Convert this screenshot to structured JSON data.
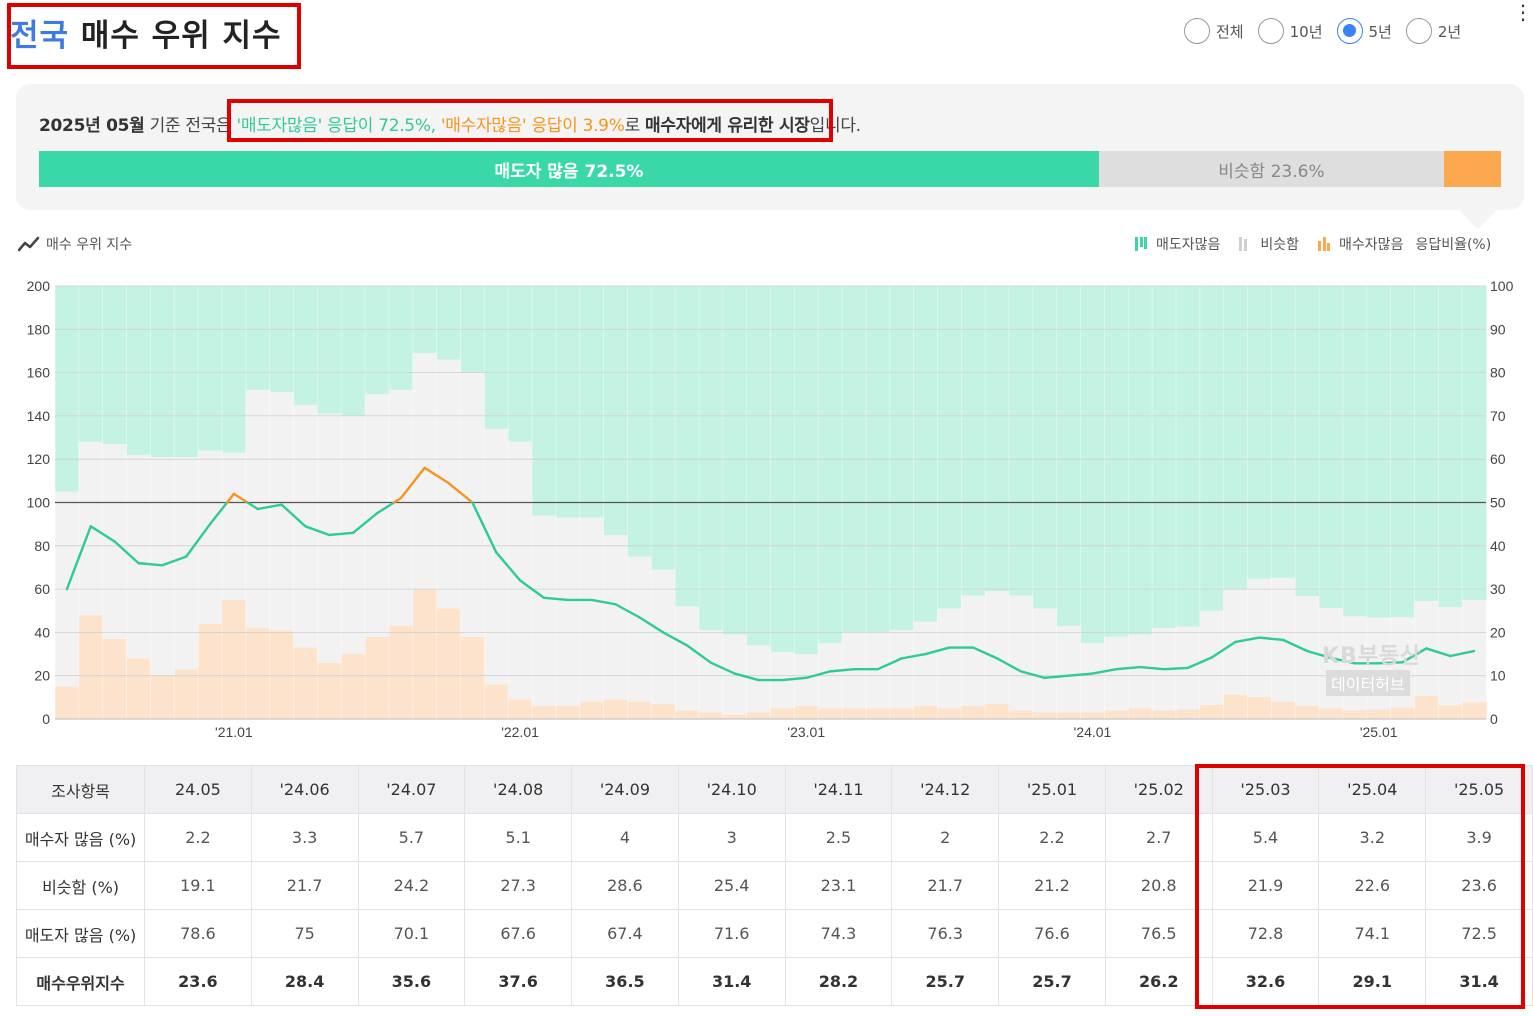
{
  "header": {
    "title_accent": "전국",
    "title_rest": " 매수 우위 지수",
    "period_options": [
      "전체",
      "10년",
      "5년",
      "2년"
    ],
    "selected_period": "5년"
  },
  "summary": {
    "date": "2025년 05월",
    "prefix": " 기준 전국은 ",
    "seller_phrase": "'매도자많음' 응답이 72.5%, ",
    "buyer_phrase": "'매수자많음' 응답이 3.9%",
    "connector": "로 ",
    "market": "매수자에게 유리한 시장",
    "suffix": "입니다.",
    "bar": {
      "seller_label": "매도자 많음 72.5%",
      "similar_label": "비슷함 23.6%",
      "seller_pct": 72.5,
      "similar_pct": 23.6,
      "buyer_pct": 3.9
    }
  },
  "chart_section": {
    "title": "매수 우위 지수",
    "legend": [
      "매도자많음",
      "비슷함",
      "매수자많음"
    ],
    "right_axis_unit": "응답비율(%)",
    "watermark_line1": "KB부동산",
    "watermark_line2": "데이터허브"
  },
  "colors": {
    "seller": "#3ad8a8",
    "seller_area": "#c4f2e3",
    "similar_area": "#f2f2f2",
    "buyer": "#fca84e",
    "buyer_area": "#fde3cb",
    "line_green": "#2ecb92",
    "line_orange": "#f7941d",
    "highlight": "#e00000",
    "accent_blue": "#3c7be0"
  },
  "chart_data": {
    "type": "area",
    "x_tick_labels": [
      "'21.01",
      "'22.01",
      "'23.01",
      "'24.01",
      "'25.01"
    ],
    "left_axis": {
      "range": [
        0,
        200
      ],
      "ticks": [
        0,
        20,
        40,
        60,
        80,
        100,
        120,
        140,
        160,
        180,
        200
      ]
    },
    "right_axis": {
      "range": [
        0,
        100
      ],
      "ticks": [
        0,
        10,
        20,
        30,
        40,
        50,
        60,
        70,
        80,
        90,
        100
      ],
      "label": "응답비율(%)"
    },
    "reference_line": 100,
    "x": [
      "20.06",
      "20.07",
      "20.08",
      "20.09",
      "20.10",
      "20.11",
      "20.12",
      "21.01",
      "21.02",
      "21.03",
      "21.04",
      "21.05",
      "21.06",
      "21.07",
      "21.08",
      "21.09",
      "21.10",
      "21.11",
      "21.12",
      "22.01",
      "22.02",
      "22.03",
      "22.04",
      "22.05",
      "22.06",
      "22.07",
      "22.08",
      "22.09",
      "22.10",
      "22.11",
      "22.12",
      "23.01",
      "23.02",
      "23.03",
      "23.04",
      "23.05",
      "23.06",
      "23.07",
      "23.08",
      "23.09",
      "23.10",
      "23.11",
      "23.12",
      "24.01",
      "24.02",
      "24.03",
      "24.04",
      "24.05",
      "24.06",
      "24.07",
      "24.08",
      "24.09",
      "24.10",
      "24.11",
      "24.12",
      "25.01",
      "25.02",
      "25.03",
      "25.04",
      "25.05"
    ],
    "series": [
      {
        "name": "매수자많음",
        "axis": "right",
        "values": [
          7.5,
          24,
          18.5,
          14,
          10,
          11.5,
          22,
          27.5,
          21,
          20.5,
          16.5,
          13,
          15,
          19,
          21.5,
          30,
          25.5,
          19,
          8,
          4.5,
          3,
          3,
          4,
          4.5,
          4,
          3.5,
          2,
          1.5,
          1,
          1.5,
          2.5,
          3,
          2.5,
          2.5,
          2.5,
          2.5,
          3,
          2.5,
          3,
          3.5,
          2,
          1.5,
          1.5,
          1.5,
          2,
          2.5,
          2,
          2.2,
          3.3,
          5.7,
          5.1,
          4,
          3,
          2.5,
          2,
          2.2,
          2.7,
          5.4,
          3.2,
          3.9
        ]
      },
      {
        "name": "비슷함",
        "axis": "right",
        "values": [
          45,
          40,
          45,
          47,
          50.5,
          49,
          40,
          34,
          55,
          55,
          56,
          57.5,
          55,
          56,
          54.5,
          54.5,
          57.5,
          61,
          59,
          59.5,
          44,
          43.5,
          42.5,
          38,
          33.5,
          31,
          24,
          19,
          18.5,
          15.5,
          13,
          12,
          15,
          17.5,
          17.5,
          18,
          19.5,
          23,
          25.5,
          26,
          26.5,
          24,
          20,
          16,
          17,
          17,
          19,
          19.1,
          21.7,
          24.2,
          27.3,
          28.6,
          25.4,
          23.1,
          21.7,
          21.2,
          20.8,
          21.9,
          22.6,
          23.6
        ]
      },
      {
        "name": "매도자많음",
        "axis": "right",
        "values": [
          47.5,
          36,
          36.5,
          39,
          39.5,
          39.5,
          38,
          38.5,
          24,
          24.5,
          27.5,
          29.5,
          30,
          25,
          24,
          15.5,
          17,
          20,
          33,
          36,
          53,
          53.5,
          53.5,
          57.5,
          62.5,
          65.5,
          74,
          79.5,
          80.5,
          83,
          84.5,
          85,
          82.5,
          80,
          80,
          79.5,
          77.5,
          74.5,
          71.5,
          70.5,
          71.5,
          74.5,
          78.5,
          82.5,
          81,
          80.5,
          79,
          78.6,
          75,
          70.1,
          67.6,
          67.4,
          71.6,
          74.3,
          76.3,
          76.6,
          76.5,
          72.8,
          74.1,
          72.5
        ]
      },
      {
        "name": "매수우위지수",
        "axis": "left",
        "values": [
          60,
          89,
          82,
          72,
          71,
          75,
          90,
          104,
          97,
          99,
          89,
          85,
          86,
          95,
          102,
          116,
          109,
          100,
          77,
          64,
          56,
          55,
          55,
          53,
          47,
          40,
          34,
          26,
          21,
          18,
          18,
          19,
          22,
          23,
          23,
          28,
          30,
          33,
          33,
          28,
          22,
          19,
          20,
          21,
          23,
          24,
          23,
          23.6,
          28.4,
          35.6,
          37.6,
          36.5,
          31.4,
          28.2,
          25.7,
          25.7,
          26.2,
          32.6,
          29.1,
          31.4
        ]
      }
    ]
  },
  "table": {
    "header_label": "조사항목",
    "columns": [
      "24.05",
      "'24.06",
      "'24.07",
      "'24.08",
      "'24.09",
      "'24.10",
      "'24.11",
      "'24.12",
      "'25.01",
      "'25.02",
      "'25.03",
      "'25.04",
      "'25.05"
    ],
    "rows": [
      {
        "label": "매수자 많음 (%)",
        "values": [
          "2.2",
          "3.3",
          "5.7",
          "5.1",
          "4",
          "3",
          "2.5",
          "2",
          "2.2",
          "2.7",
          "5.4",
          "3.2",
          "3.9"
        ]
      },
      {
        "label": "비슷함 (%)",
        "values": [
          "19.1",
          "21.7",
          "24.2",
          "27.3",
          "28.6",
          "25.4",
          "23.1",
          "21.7",
          "21.2",
          "20.8",
          "21.9",
          "22.6",
          "23.6"
        ]
      },
      {
        "label": "매도자 많음 (%)",
        "values": [
          "78.6",
          "75",
          "70.1",
          "67.6",
          "67.4",
          "71.6",
          "74.3",
          "76.3",
          "76.6",
          "76.5",
          "72.8",
          "74.1",
          "72.5"
        ]
      },
      {
        "label": "매수우위지수",
        "values": [
          "23.6",
          "28.4",
          "35.6",
          "37.6",
          "36.5",
          "31.4",
          "28.2",
          "25.7",
          "25.7",
          "26.2",
          "32.6",
          "29.1",
          "31.4"
        ]
      }
    ]
  }
}
